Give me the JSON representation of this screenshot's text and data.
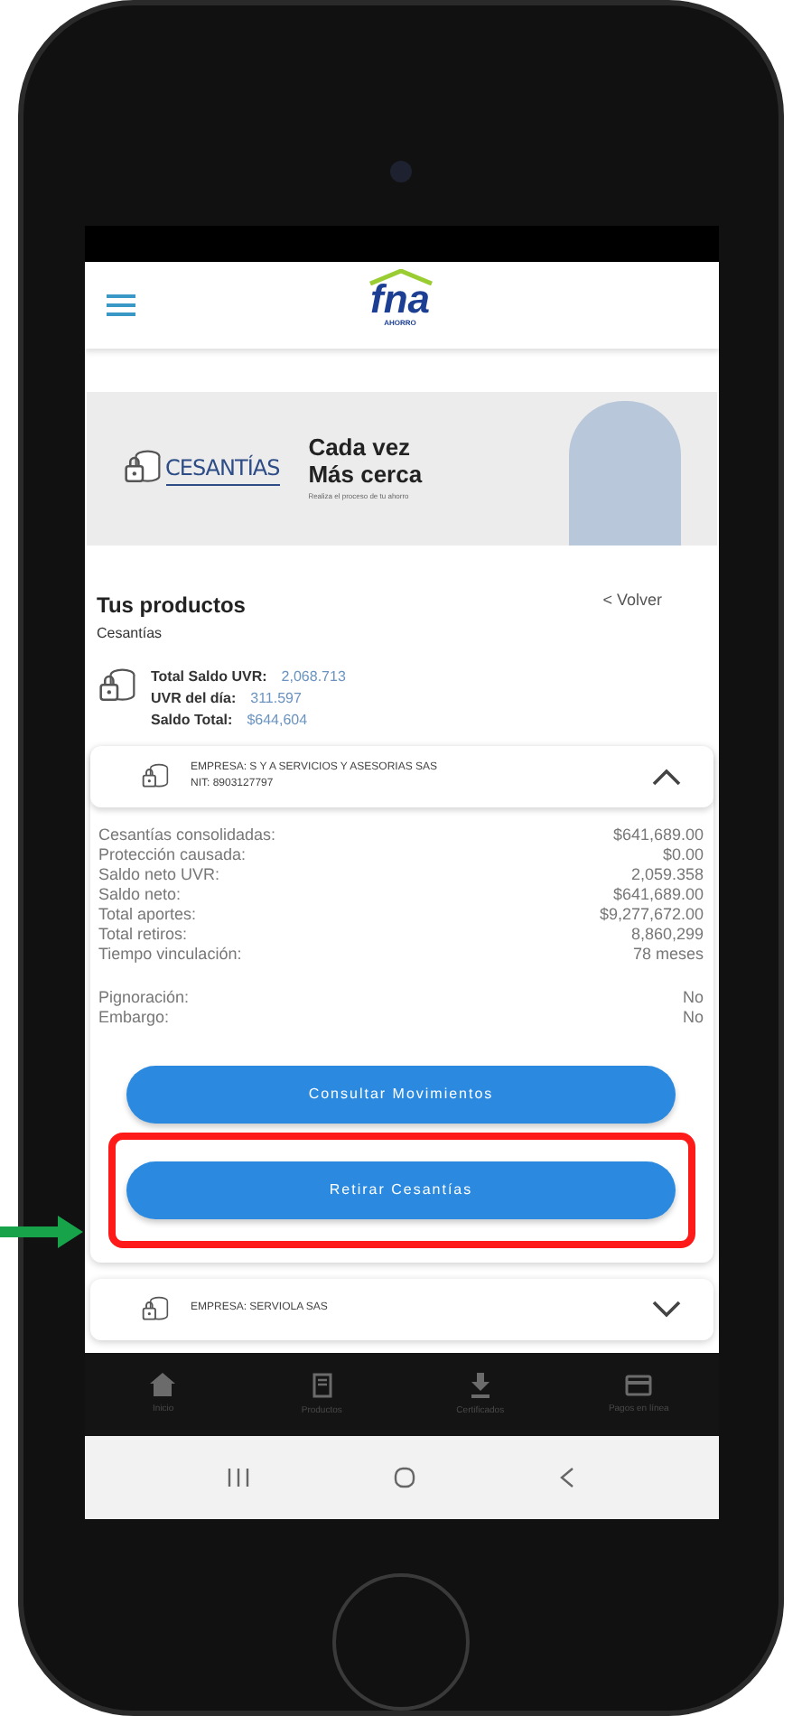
{
  "header": {
    "logo": "fna",
    "logo_sub": "AHORRO"
  },
  "banner": {
    "brand": "CESANTÍAS",
    "title_lines": [
      "Cada vez",
      "Más cerca"
    ],
    "subtitle": "Realiza el proceso de tu ahorro"
  },
  "products": {
    "title": "Tus productos",
    "subtitle": "Cesantías",
    "back": "< Volver",
    "summary": [
      {
        "label": "Total Saldo UVR:",
        "value": "2,068.713"
      },
      {
        "label": "UVR del día:",
        "value": "311.597"
      },
      {
        "label": "Saldo Total:",
        "value": "$644,604"
      }
    ]
  },
  "accounts": [
    {
      "company": "EMPRESA: S Y A SERVICIOS Y ASESORIAS SAS",
      "nit": "NIT: 8903127797",
      "expanded": true,
      "details": [
        {
          "label": "Cesantías consolidadas:",
          "value": "$641,689.00"
        },
        {
          "label": "Protección causada:",
          "value": "$0.00"
        },
        {
          "label": "Saldo neto UVR:",
          "value": "2,059.358"
        },
        {
          "label": "Saldo neto:",
          "value": "$641,689.00"
        },
        {
          "label": "Total aportes:",
          "value": "$9,277,672.00"
        },
        {
          "label": "Total retiros:",
          "value": "8,860,299"
        },
        {
          "label": "Tiempo vinculación:",
          "value": "78 meses"
        }
      ],
      "extra": [
        {
          "label": "Pignoración:",
          "value": "No"
        },
        {
          "label": "Embargo:",
          "value": "No"
        }
      ],
      "buttons": [
        {
          "label": "Consultar Movimientos",
          "highlighted": false
        },
        {
          "label": "Retirar Cesantías",
          "highlighted": true
        }
      ]
    },
    {
      "company": "EMPRESA: SERVIOLA SAS",
      "expanded": false
    }
  ],
  "bottom_nav": [
    {
      "label": "Inicio",
      "kind": "home"
    },
    {
      "label": "Productos",
      "kind": "document"
    },
    {
      "label": "Certificados",
      "kind": "download"
    },
    {
      "label": "Pagos en línea",
      "kind": "card"
    }
  ]
}
